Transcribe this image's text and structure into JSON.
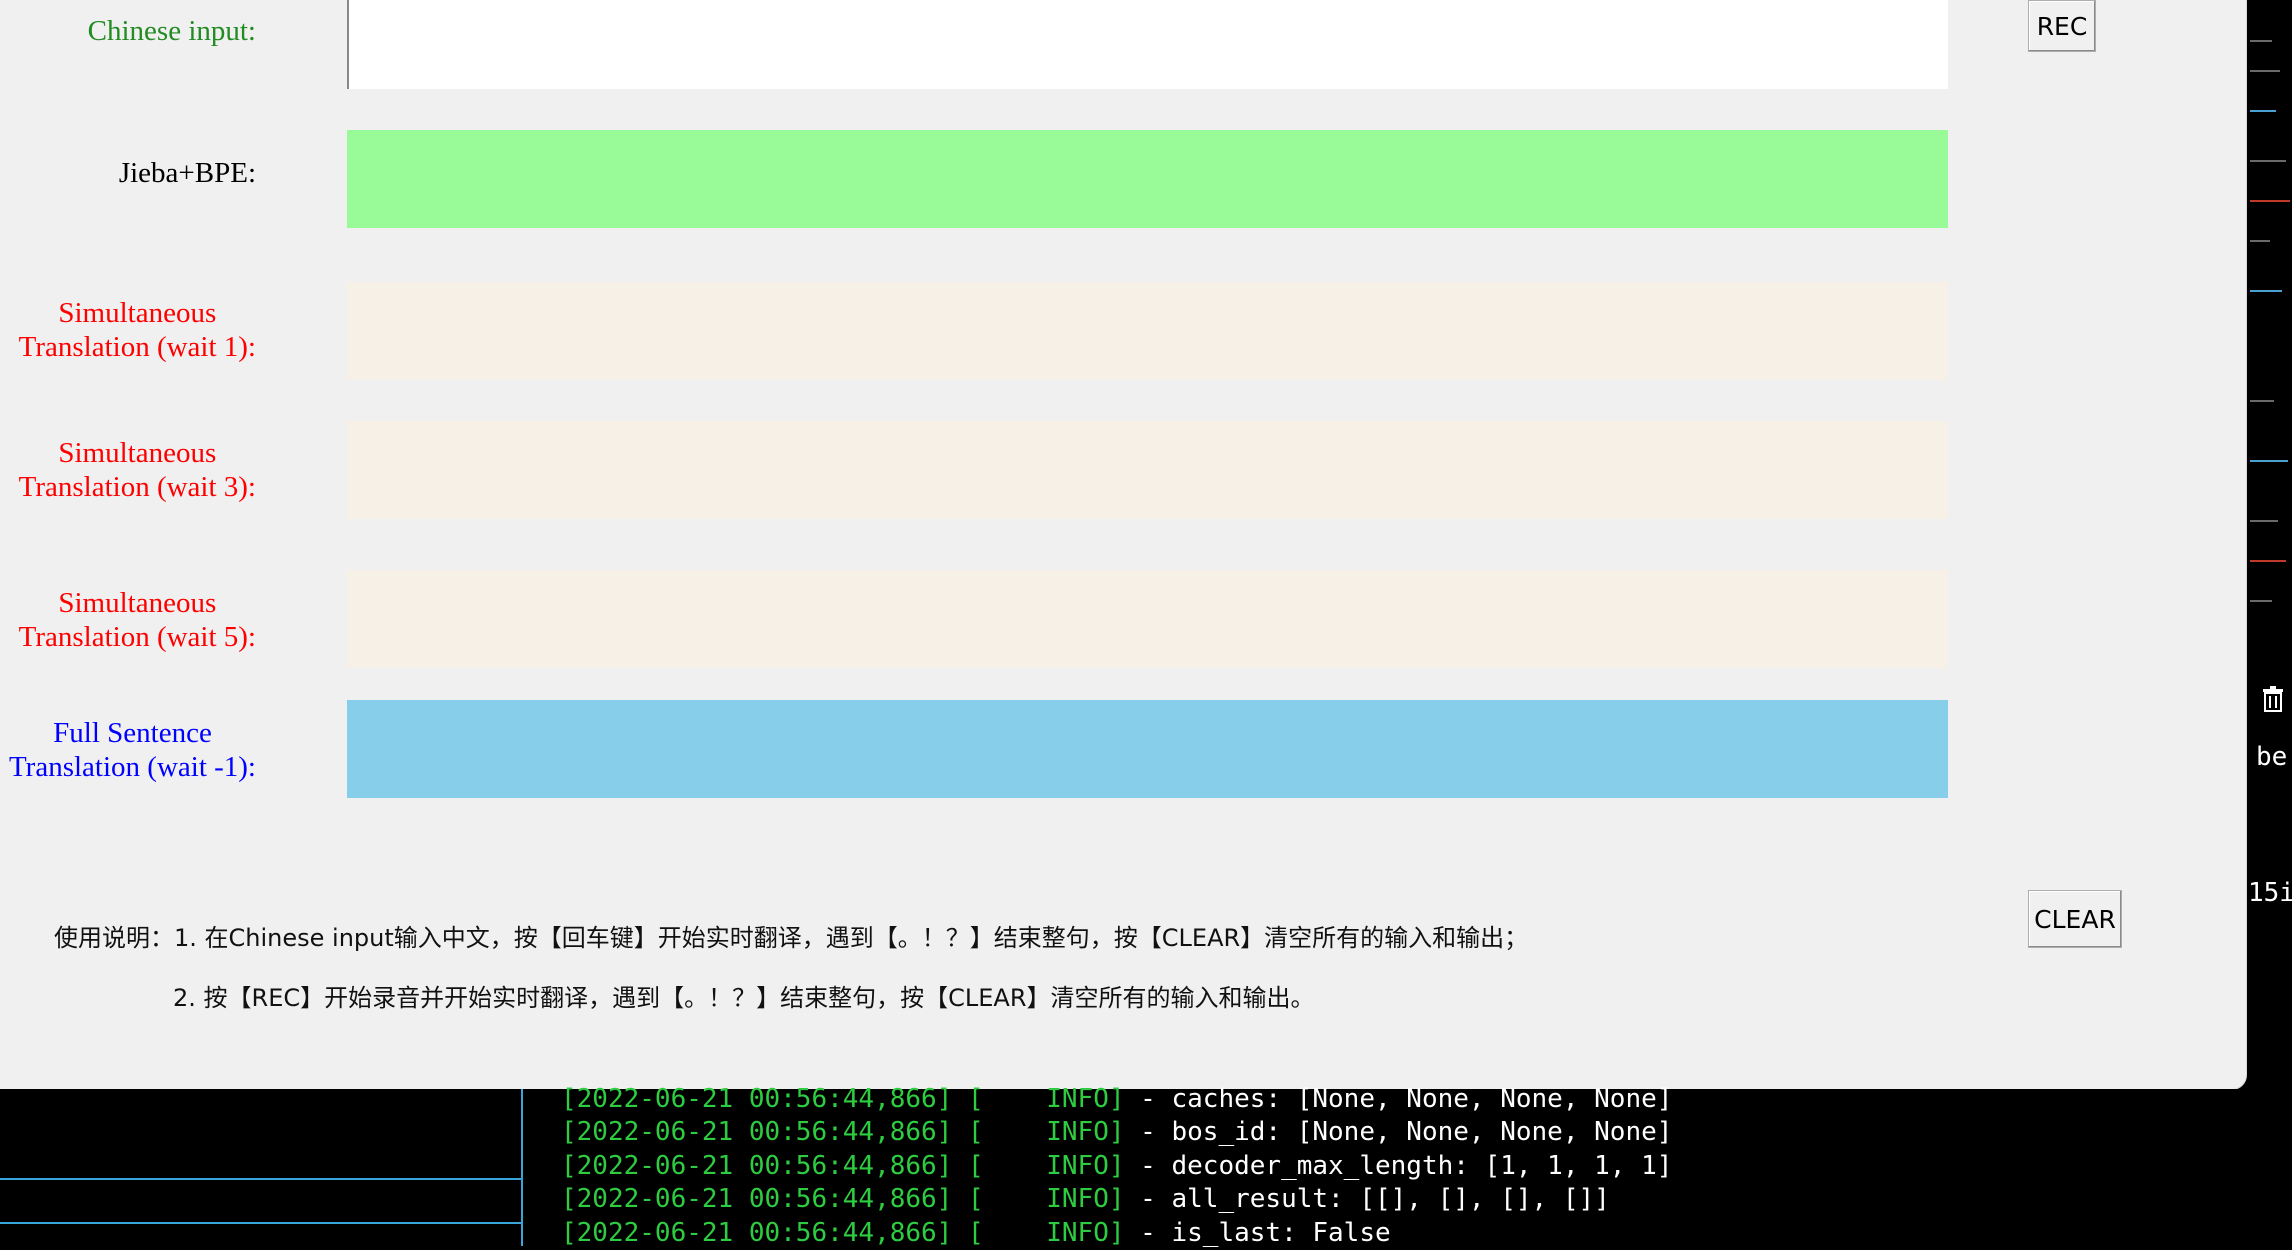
{
  "labels": {
    "chinese_input": "Chinese input:",
    "jieba_bpe": "Jieba+BPE:",
    "wait1_l1": "Simultaneous",
    "wait1_l2": "Translation (wait 1):",
    "wait3_l1": "Simultaneous",
    "wait3_l2": "Translation (wait 3):",
    "wait5_l1": "Simultaneous",
    "wait5_l2": "Translation (wait 5):",
    "full_l1": "Full Sentence",
    "full_l2": "Translation (wait -1):"
  },
  "inputs": {
    "chinese_input_value": ""
  },
  "buttons": {
    "rec": "REC",
    "clear": "CLEAR"
  },
  "help": {
    "line1": "使用说明：1. 在Chinese input输入中文，按【回车键】开始实时翻译，遇到【。！？】结束整句，按【CLEAR】清空所有的输入和输出；",
    "line2": "2. 按【REC】开始录音并开始实时翻译，遇到【。！？】结束整句，按【CLEAR】清空所有的输入和输出。"
  },
  "colors": {
    "chinese_label": "#228b22",
    "jieba_label": "#000000",
    "sim_label": "#ff0000",
    "full_label": "#0000ff",
    "jieba_bg": "#98fb98",
    "sim_bg": "#f7f0e6",
    "full_bg": "#87ceeb"
  },
  "terminal": {
    "lines": [
      {
        "prefix": "[2022-06-21 00:56:44,866] [    INFO]",
        "msg": " - caches: [None, None, None, None]"
      },
      {
        "prefix": "[2022-06-21 00:56:44,866] [    INFO]",
        "msg": " - bos_id: [None, None, None, None]"
      },
      {
        "prefix": "[2022-06-21 00:56:44,866] [    INFO]",
        "msg": " - decoder_max_length: [1, 1, 1, 1]"
      },
      {
        "prefix": "[2022-06-21 00:56:44,866] [    INFO]",
        "msg": " - all_result: [[], [], [], []]"
      },
      {
        "prefix": "[2022-06-21 00:56:44,866] [    INFO]",
        "msg": " - is_last: False"
      }
    ],
    "edge_text_1": "be",
    "edge_text_2": "15i",
    "trash_icon": "trash-icon"
  }
}
